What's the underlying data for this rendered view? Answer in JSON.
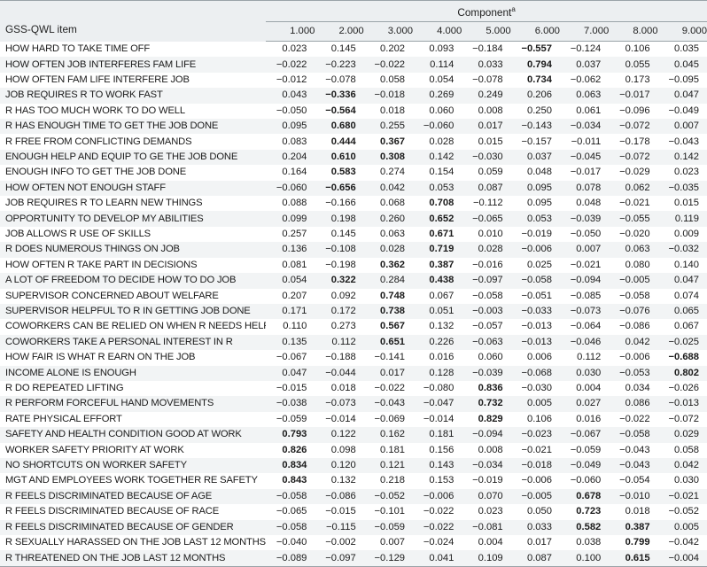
{
  "table": {
    "item_column_header": "GSS-QWL item",
    "group_header": "Component",
    "group_header_superscript": "a",
    "component_labels": [
      "1.000",
      "2.000",
      "3.000",
      "4.000",
      "5.000",
      "6.000",
      "7.000",
      "8.000",
      "9.000"
    ],
    "colors": {
      "header_background": "#eceff1",
      "row_stripe": "#f2f4f5",
      "row_plain": "#ffffff",
      "rule": "#9aa3a8",
      "text": "#1a1a1a"
    },
    "bold_threshold_note": "values with absolute loading at or above about 0.30 on their dominant component are bold",
    "rows": [
      {
        "label": "HOW HARD TO TAKE TIME OFF",
        "values": [
          "0.023",
          "0.145",
          "0.202",
          "0.093",
          "−0.184",
          "−0.557",
          "−0.124",
          "0.106",
          "0.035"
        ],
        "bold": [
          false,
          false,
          false,
          false,
          false,
          true,
          false,
          false,
          false
        ]
      },
      {
        "label": "HOW OFTEN JOB INTERFERES FAM LIFE",
        "values": [
          "−0.022",
          "−0.223",
          "−0.022",
          "0.114",
          "0.033",
          "0.794",
          "0.037",
          "0.055",
          "0.045"
        ],
        "bold": [
          false,
          false,
          false,
          false,
          false,
          true,
          false,
          false,
          false
        ]
      },
      {
        "label": "HOW OFTEN FAM LIFE INTERFERE JOB",
        "values": [
          "−0.012",
          "−0.078",
          "0.058",
          "0.054",
          "−0.078",
          "0.734",
          "−0.062",
          "0.173",
          "−0.095"
        ],
        "bold": [
          false,
          false,
          false,
          false,
          false,
          true,
          false,
          false,
          false
        ]
      },
      {
        "label": "JOB REQUIRES R TO WORK FAST",
        "values": [
          "0.043",
          "−0.336",
          "−0.018",
          "0.269",
          "0.249",
          "0.206",
          "0.063",
          "−0.017",
          "0.047"
        ],
        "bold": [
          false,
          true,
          false,
          false,
          false,
          false,
          false,
          false,
          false
        ]
      },
      {
        "label": "R HAS TOO MUCH WORK TO DO WELL",
        "values": [
          "−0.050",
          "−0.564",
          "0.018",
          "0.060",
          "0.008",
          "0.250",
          "0.061",
          "−0.096",
          "−0.049"
        ],
        "bold": [
          false,
          true,
          false,
          false,
          false,
          false,
          false,
          false,
          false
        ]
      },
      {
        "label": "R HAS ENOUGH TIME TO GET THE JOB DONE",
        "values": [
          "0.095",
          "0.680",
          "0.255",
          "−0.060",
          "0.017",
          "−0.143",
          "−0.034",
          "−0.072",
          "0.007"
        ],
        "bold": [
          false,
          true,
          false,
          false,
          false,
          false,
          false,
          false,
          false
        ]
      },
      {
        "label": "R FREE FROM CONFLICTING DEMANDS",
        "values": [
          "0.083",
          "0.444",
          "0.367",
          "0.028",
          "0.015",
          "−0.157",
          "−0.011",
          "−0.178",
          "−0.043"
        ],
        "bold": [
          false,
          true,
          true,
          false,
          false,
          false,
          false,
          false,
          false
        ]
      },
      {
        "label": "ENOUGH HELP AND EQUIP TO GE THE JOB DONE",
        "values": [
          "0.204",
          "0.610",
          "0.308",
          "0.142",
          "−0.030",
          "0.037",
          "−0.045",
          "−0.072",
          "0.142"
        ],
        "bold": [
          false,
          true,
          true,
          false,
          false,
          false,
          false,
          false,
          false
        ]
      },
      {
        "label": "ENOUGH INFO TO GET THE JOB DONE",
        "values": [
          "0.164",
          "0.583",
          "0.274",
          "0.154",
          "0.059",
          "0.048",
          "−0.017",
          "−0.029",
          "0.023"
        ],
        "bold": [
          false,
          true,
          false,
          false,
          false,
          false,
          false,
          false,
          false
        ]
      },
      {
        "label": "HOW OFTEN NOT ENOUGH STAFF",
        "values": [
          "−0.060",
          "−0.656",
          "0.042",
          "0.053",
          "0.087",
          "0.095",
          "0.078",
          "0.062",
          "−0.035"
        ],
        "bold": [
          false,
          true,
          false,
          false,
          false,
          false,
          false,
          false,
          false
        ]
      },
      {
        "label": "JOB REQUIRES R TO LEARN NEW THINGS",
        "values": [
          "0.088",
          "−0.166",
          "0.068",
          "0.708",
          "−0.112",
          "0.095",
          "0.048",
          "−0.021",
          "0.015"
        ],
        "bold": [
          false,
          false,
          false,
          true,
          false,
          false,
          false,
          false,
          false
        ]
      },
      {
        "label": "OPPORTUNITY TO DEVELOP MY ABILITIES",
        "values": [
          "0.099",
          "0.198",
          "0.260",
          "0.652",
          "−0.065",
          "0.053",
          "−0.039",
          "−0.055",
          "0.119"
        ],
        "bold": [
          false,
          false,
          false,
          true,
          false,
          false,
          false,
          false,
          false
        ]
      },
      {
        "label": "JOB ALLOWS R USE OF SKILLS",
        "values": [
          "0.257",
          "0.145",
          "0.063",
          "0.671",
          "0.010",
          "−0.019",
          "−0.050",
          "−0.020",
          "0.009"
        ],
        "bold": [
          false,
          false,
          false,
          true,
          false,
          false,
          false,
          false,
          false
        ]
      },
      {
        "label": "R DOES NUMEROUS THINGS ON JOB",
        "values": [
          "0.136",
          "−0.108",
          "0.028",
          "0.719",
          "0.028",
          "−0.006",
          "0.007",
          "0.063",
          "−0.032"
        ],
        "bold": [
          false,
          false,
          false,
          true,
          false,
          false,
          false,
          false,
          false
        ]
      },
      {
        "label": "HOW OFTEN R TAKE PART IN DECISIONS",
        "values": [
          "0.081",
          "−0.198",
          "0.362",
          "0.387",
          "−0.016",
          "0.025",
          "−0.021",
          "0.080",
          "0.140"
        ],
        "bold": [
          false,
          false,
          true,
          true,
          false,
          false,
          false,
          false,
          false
        ]
      },
      {
        "label": "A LOT OF FREEDOM TO DECIDE HOW TO DO JOB",
        "values": [
          "0.054",
          "0.322",
          "0.284",
          "0.438",
          "−0.097",
          "−0.058",
          "−0.094",
          "−0.005",
          "0.047"
        ],
        "bold": [
          false,
          true,
          false,
          true,
          false,
          false,
          false,
          false,
          false
        ]
      },
      {
        "label": "SUPERVISOR CONCERNED ABOUT WELFARE",
        "values": [
          "0.207",
          "0.092",
          "0.748",
          "0.067",
          "−0.058",
          "−0.051",
          "−0.085",
          "−0.058",
          "0.074"
        ],
        "bold": [
          false,
          false,
          true,
          false,
          false,
          false,
          false,
          false,
          false
        ]
      },
      {
        "label": "SUPERVISOR HELPFUL TO R IN GETTING JOB DONE",
        "values": [
          "0.171",
          "0.172",
          "0.738",
          "0.051",
          "−0.003",
          "−0.033",
          "−0.073",
          "−0.076",
          "0.065"
        ],
        "bold": [
          false,
          false,
          true,
          false,
          false,
          false,
          false,
          false,
          false
        ]
      },
      {
        "label": "COWORKERS CAN BE RELIED ON WHEN R NEEDS HELP",
        "values": [
          "0.110",
          "0.273",
          "0.567",
          "0.132",
          "−0.057",
          "−0.013",
          "−0.064",
          "−0.086",
          "0.067"
        ],
        "bold": [
          false,
          false,
          true,
          false,
          false,
          false,
          false,
          false,
          false
        ]
      },
      {
        "label": "COWORKERS TAKE A PERSONAL INTEREST IN R",
        "values": [
          "0.135",
          "0.112",
          "0.651",
          "0.226",
          "−0.063",
          "−0.013",
          "−0.046",
          "0.042",
          "−0.025"
        ],
        "bold": [
          false,
          false,
          true,
          false,
          false,
          false,
          false,
          false,
          false
        ]
      },
      {
        "label": "HOW FAIR IS WHAT R EARN ON THE JOB",
        "values": [
          "−0.067",
          "−0.188",
          "−0.141",
          "0.016",
          "0.060",
          "0.006",
          "0.112",
          "−0.006",
          "−0.688"
        ],
        "bold": [
          false,
          false,
          false,
          false,
          false,
          false,
          false,
          false,
          true
        ]
      },
      {
        "label": "INCOME ALONE IS ENOUGH",
        "values": [
          "0.047",
          "−0.044",
          "0.017",
          "0.128",
          "−0.039",
          "−0.068",
          "0.030",
          "−0.053",
          "0.802"
        ],
        "bold": [
          false,
          false,
          false,
          false,
          false,
          false,
          false,
          false,
          true
        ]
      },
      {
        "label": "R DO REPEATED LIFTING",
        "values": [
          "−0.015",
          "0.018",
          "−0.022",
          "−0.080",
          "0.836",
          "−0.030",
          "0.004",
          "0.034",
          "−0.026"
        ],
        "bold": [
          false,
          false,
          false,
          false,
          true,
          false,
          false,
          false,
          false
        ]
      },
      {
        "label": "R PERFORM FORCEFUL HAND MOVEMENTS",
        "values": [
          "−0.038",
          "−0.073",
          "−0.043",
          "−0.047",
          "0.732",
          "0.005",
          "0.027",
          "0.086",
          "−0.013"
        ],
        "bold": [
          false,
          false,
          false,
          false,
          true,
          false,
          false,
          false,
          false
        ]
      },
      {
        "label": "RATE PHYSICAL EFFORT",
        "values": [
          "−0.059",
          "−0.014",
          "−0.069",
          "−0.014",
          "0.829",
          "0.106",
          "0.016",
          "−0.022",
          "−0.072"
        ],
        "bold": [
          false,
          false,
          false,
          false,
          true,
          false,
          false,
          false,
          false
        ]
      },
      {
        "label": "SAFETY AND HEALTH CONDITION GOOD AT WORK",
        "values": [
          "0.793",
          "0.122",
          "0.162",
          "0.181",
          "−0.094",
          "−0.023",
          "−0.067",
          "−0.058",
          "0.029"
        ],
        "bold": [
          true,
          false,
          false,
          false,
          false,
          false,
          false,
          false,
          false
        ]
      },
      {
        "label": "WORKER SAFETY PRIORITY AT WORK",
        "values": [
          "0.826",
          "0.098",
          "0.181",
          "0.156",
          "0.008",
          "−0.021",
          "−0.059",
          "−0.043",
          "0.058"
        ],
        "bold": [
          true,
          false,
          false,
          false,
          false,
          false,
          false,
          false,
          false
        ]
      },
      {
        "label": "NO SHORTCUTS ON WORKER SAFETY",
        "values": [
          "0.834",
          "0.120",
          "0.121",
          "0.143",
          "−0.034",
          "−0.018",
          "−0.049",
          "−0.043",
          "0.042"
        ],
        "bold": [
          true,
          false,
          false,
          false,
          false,
          false,
          false,
          false,
          false
        ]
      },
      {
        "label": "MGT AND EMPLOYEES WORK TOGETHER RE SAFETY",
        "values": [
          "0.843",
          "0.132",
          "0.218",
          "0.153",
          "−0.019",
          "−0.006",
          "−0.060",
          "−0.054",
          "0.030"
        ],
        "bold": [
          true,
          false,
          false,
          false,
          false,
          false,
          false,
          false,
          false
        ]
      },
      {
        "label": "R FEELS DISCRIMINATED BECAUSE OF AGE",
        "values": [
          "−0.058",
          "−0.086",
          "−0.052",
          "−0.006",
          "0.070",
          "−0.005",
          "0.678",
          "−0.010",
          "−0.021"
        ],
        "bold": [
          false,
          false,
          false,
          false,
          false,
          false,
          true,
          false,
          false
        ]
      },
      {
        "label": "R FEELS DISCRIMINATED BECAUSE OF RACE",
        "values": [
          "−0.065",
          "−0.015",
          "−0.101",
          "−0.022",
          "0.023",
          "0.050",
          "0.723",
          "0.018",
          "−0.052"
        ],
        "bold": [
          false,
          false,
          false,
          false,
          false,
          false,
          true,
          false,
          false
        ]
      },
      {
        "label": "R FEELS DISCRIMINATED BECAUSE OF GENDER",
        "values": [
          "−0.058",
          "−0.115",
          "−0.059",
          "−0.022",
          "−0.081",
          "0.033",
          "0.582",
          "0.387",
          "0.005"
        ],
        "bold": [
          false,
          false,
          false,
          false,
          false,
          false,
          true,
          true,
          false
        ]
      },
      {
        "label": "R SEXUALLY HARASSED ON THE JOB LAST 12 MONTHS",
        "values": [
          "−0.040",
          "−0.002",
          "0.007",
          "−0.024",
          "0.004",
          "0.017",
          "0.038",
          "0.799",
          "−0.042"
        ],
        "bold": [
          false,
          false,
          false,
          false,
          false,
          false,
          false,
          true,
          false
        ]
      },
      {
        "label": "R THREATENED ON THE JOB LAST 12 MONTHS",
        "values": [
          "−0.089",
          "−0.097",
          "−0.129",
          "0.041",
          "0.109",
          "0.087",
          "0.100",
          "0.615",
          "−0.004"
        ],
        "bold": [
          false,
          false,
          false,
          false,
          false,
          false,
          false,
          true,
          false
        ]
      }
    ]
  }
}
